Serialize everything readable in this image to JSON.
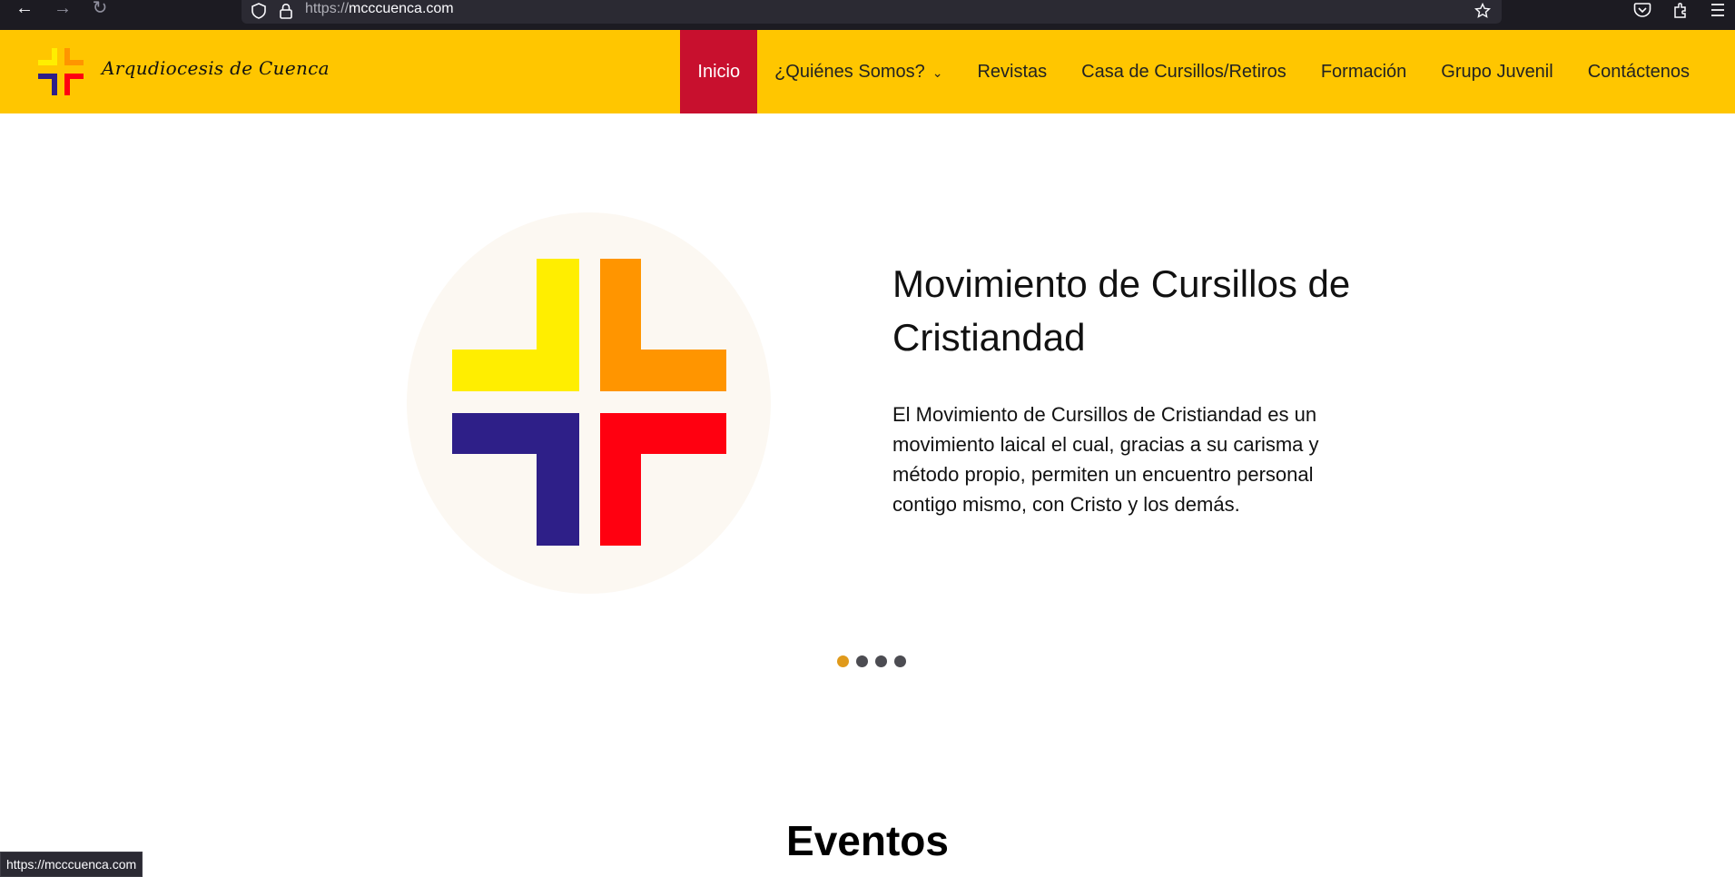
{
  "browser": {
    "url_prefix": "https://",
    "url_host": "mcccuenca.com",
    "status_url": "https://mcccuenca.com"
  },
  "header": {
    "brand": "Arqudiocesis de Cuenca",
    "menu": [
      {
        "label": "Inicio",
        "active": true
      },
      {
        "label": "¿Quiénes Somos?",
        "has_dropdown": true
      },
      {
        "label": "Revistas"
      },
      {
        "label": "Casa de Cursillos/Retiros"
      },
      {
        "label": "Formación"
      },
      {
        "label": "Grupo Juvenil"
      },
      {
        "label": "Contáctenos"
      }
    ]
  },
  "hero": {
    "title": "Movimiento de Cursillos de Cristiandad",
    "text": "El Movimiento de Cursillos de Cristiandad es un movimiento laical el cual, gracias a su carisma y método propio, permiten un encuentro personal contigo mismo, con Cristo y los demás.",
    "slides_total": 4,
    "active_slide": 1
  },
  "sections": {
    "events_title": "Eventos"
  },
  "colors": {
    "header_bg": "#ffc600",
    "active_menu": "#c8102e",
    "cross_yellow": "#ffee00",
    "cross_orange": "#ff9500",
    "cross_blue": "#2e1f88",
    "cross_red": "#ff0010",
    "dot_active": "#e09a1b"
  }
}
